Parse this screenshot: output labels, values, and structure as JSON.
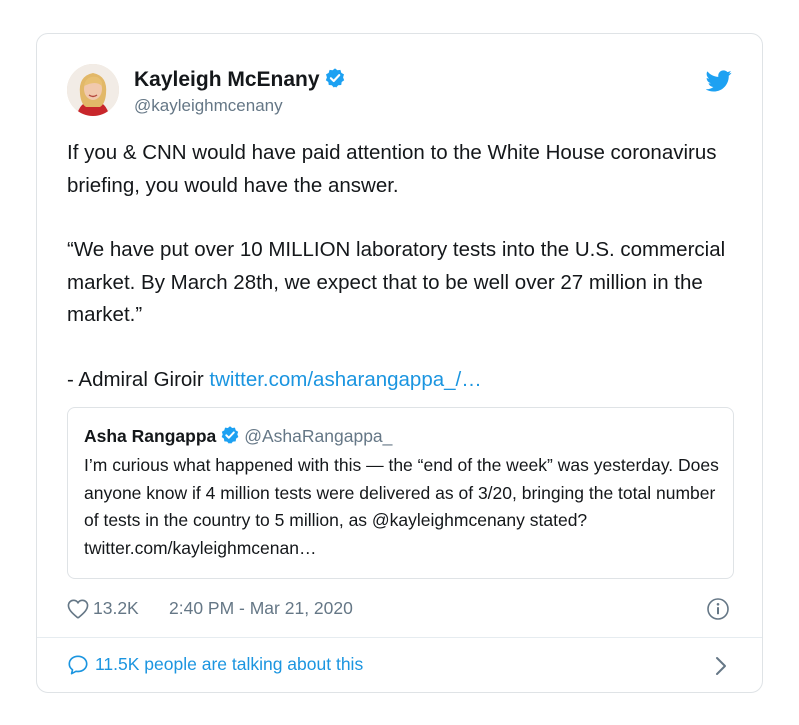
{
  "tweet": {
    "author": {
      "name": "Kayleigh McEnany",
      "handle": "@kayleighmcenany",
      "verified": true
    },
    "paragraphs": [
      "If you & CNN would have paid attention to the White House coronavirus briefing, you would have the answer.",
      "“We have put over 10 MILLION laboratory tests into the U.S. commercial market. By March 28th, we expect that to be well over 27 million in the market.”"
    ],
    "attribution": "- Admiral Giroir",
    "link_text": "twitter.com/asharangappa_/…",
    "quoted_tweet": {
      "name": "Asha Rangappa",
      "handle": "@AshaRangappa_",
      "verified": true,
      "text": "I’m curious what happened with this — the “end of the week” was yesterday. Does anyone know if 4 million tests were delivered as of 3/20, bringing the total number of tests in the country to 5 million, as @kayleighmcenany stated? twitter.com/kayleighmcenan…"
    },
    "like_count": "13.2K",
    "timestamp": "2:40 PM - Mar 21, 2020",
    "talking_about": "11.5K people are talking about this"
  },
  "icons": {
    "logo": "twitter-bird-icon",
    "verified": "verified-badge-icon",
    "like": "heart-icon",
    "info": "info-icon",
    "comment": "comment-bubble-icon",
    "chevron": "chevron-right-icon"
  },
  "colors": {
    "brand": "#1da1f2",
    "link": "#1b95e0",
    "text": "#14171a",
    "secondary": "#657786",
    "border": "#dfe3e6"
  }
}
